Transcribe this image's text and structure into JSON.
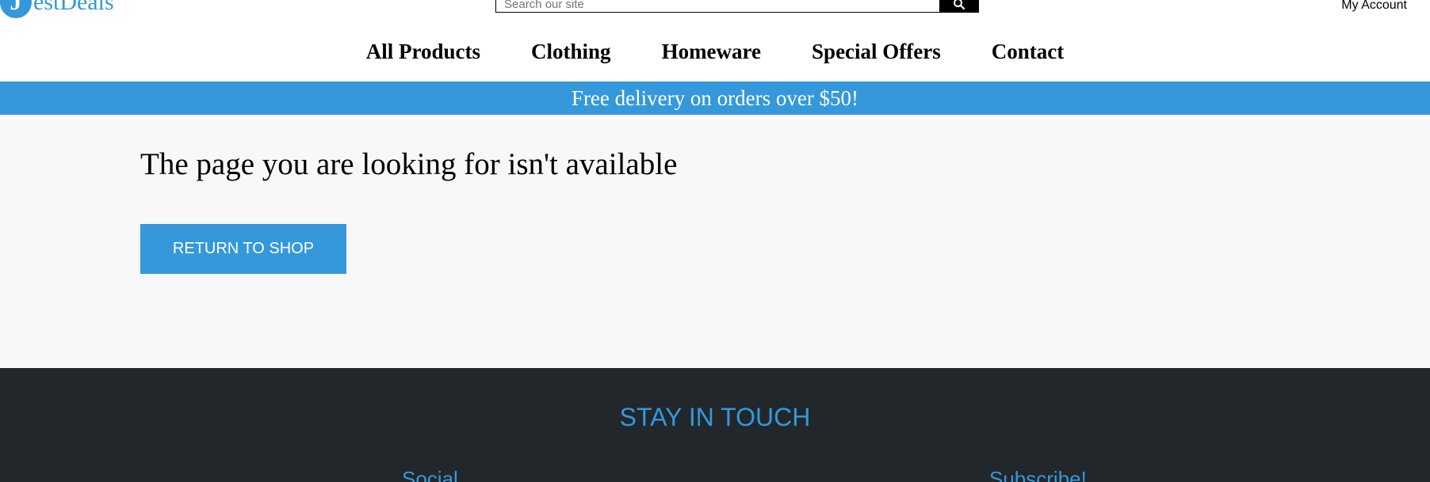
{
  "header": {
    "logo": {
      "initial": "J",
      "text": "estDeals"
    },
    "search": {
      "placeholder": "Search our site",
      "icon": "search-icon"
    },
    "account_label": "My Account"
  },
  "nav": {
    "items": [
      {
        "label": "All Products"
      },
      {
        "label": "Clothing"
      },
      {
        "label": "Homeware"
      },
      {
        "label": "Special Offers"
      },
      {
        "label": "Contact"
      }
    ]
  },
  "banner": {
    "text": "Free delivery on orders over $50!"
  },
  "main": {
    "title": "The page you are looking for isn't available",
    "return_button": "RETURN TO SHOP"
  },
  "footer": {
    "heading": "STAY IN TOUCH",
    "social_label": "Social",
    "subscribe_label": "Subscribe!"
  },
  "colors": {
    "accent": "#3498db",
    "footer_bg": "#22272b",
    "main_bg": "#f8f8f8"
  }
}
